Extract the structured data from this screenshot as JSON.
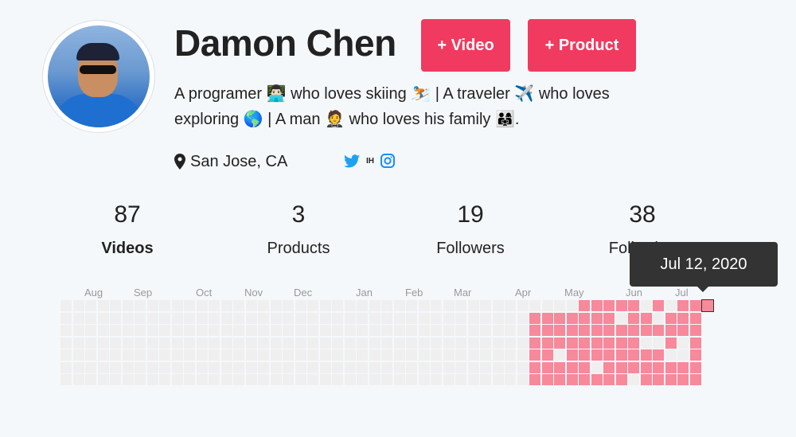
{
  "profile": {
    "name": "Damon Chen",
    "bio": "A programer 👨🏻‍💻 who loves skiing ⛷️ | A traveler ✈️ who loves exploring 🌎 | A man 🤵 who loves his family 👨‍👩‍👧.",
    "location": "San Jose, CA",
    "social_ih": "IH"
  },
  "actions": {
    "video_label": "+ Video",
    "product_label": "+ Product"
  },
  "stats": [
    {
      "value": "87",
      "label": "Videos"
    },
    {
      "value": "3",
      "label": "Products"
    },
    {
      "value": "19",
      "label": "Followers"
    },
    {
      "value": "38",
      "label": "Following"
    }
  ],
  "calendar": {
    "months": [
      "Aug",
      "Sep",
      "Oct",
      "Nov",
      "Dec",
      "Jan",
      "Feb",
      "Mar",
      "Apr",
      "May",
      "Jun",
      "Jul"
    ],
    "tooltip": "Jul 12, 2020",
    "colors": {
      "empty": "#efefef",
      "active": "#f7899b",
      "button": "#f03a5f"
    }
  }
}
